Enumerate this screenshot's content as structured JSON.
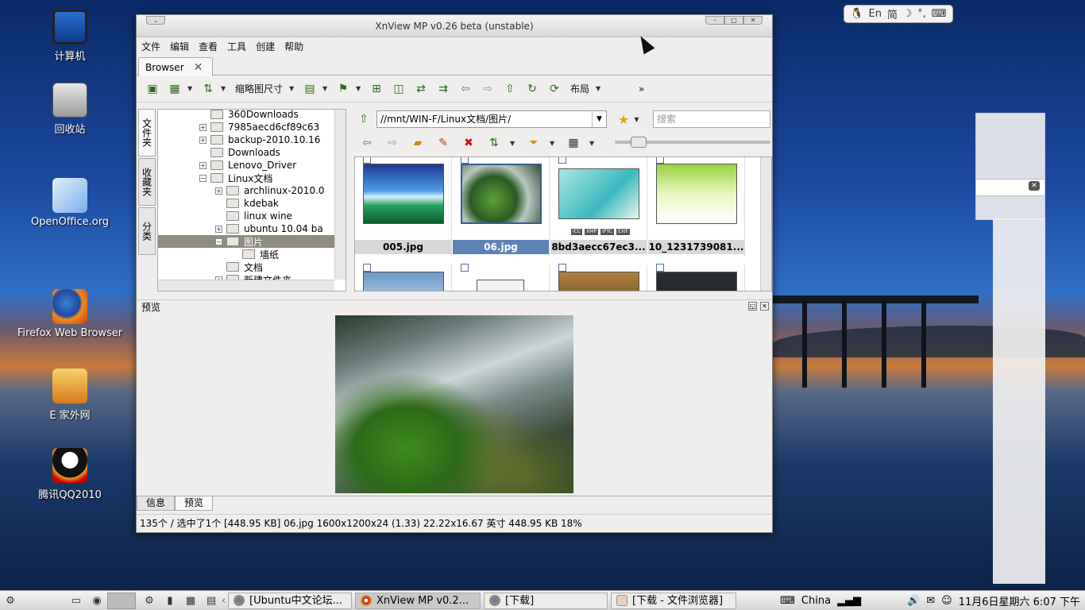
{
  "desktop": {
    "icons": [
      {
        "label": "计算机"
      },
      {
        "label": "回收站"
      },
      {
        "label": "OpenOffice.org"
      },
      {
        "label": "Firefox Web Browser"
      },
      {
        "label": "E 家外网"
      },
      {
        "label": "腾讯QQ2010"
      }
    ]
  },
  "imbar": {
    "lang": "En",
    "mode": "简",
    "moon": "☽",
    "punct": "°,",
    "keyboard": "⌨",
    "penguin": "🐧"
  },
  "window": {
    "title": "XnView MP v0.26 beta (unstable)",
    "menu": [
      "文件",
      "编辑",
      "查看",
      "工具",
      "创建",
      "帮助"
    ],
    "tab": {
      "label": "Browser",
      "close": "✕"
    },
    "toolbar": {
      "thumb_size_label": "缩略图尺寸",
      "layout_label": "布局",
      "more": "»"
    },
    "side_tabs": [
      "文件夹",
      "收藏夹",
      "分类"
    ],
    "tree": [
      {
        "label": "360Downloads",
        "indent": 0,
        "expander": ""
      },
      {
        "label": "7985aecd6cf89c63",
        "indent": 0,
        "expander": "+"
      },
      {
        "label": "backup-2010.10.16",
        "indent": 0,
        "expander": "+"
      },
      {
        "label": "Downloads",
        "indent": 0,
        "expander": ""
      },
      {
        "label": "Lenovo_Driver",
        "indent": 0,
        "expander": "+"
      },
      {
        "label": "Linux文档",
        "indent": 0,
        "expander": "−"
      },
      {
        "label": "archlinux-2010.0",
        "indent": 1,
        "expander": "+"
      },
      {
        "label": "kdebak",
        "indent": 1,
        "expander": ""
      },
      {
        "label": "linux wine",
        "indent": 1,
        "expander": ""
      },
      {
        "label": "ubuntu 10.04 ba",
        "indent": 1,
        "expander": "+"
      },
      {
        "label": "图片",
        "indent": 1,
        "expander": "−",
        "selected": true
      },
      {
        "label": "墙纸",
        "indent": 2,
        "expander": ""
      },
      {
        "label": "文档",
        "indent": 1,
        "expander": ""
      },
      {
        "label": "新建文件夹",
        "indent": 1,
        "expander": "+"
      }
    ],
    "address": "//mnt/WIN-F/Linux文档/图片/",
    "search_placeholder": "搜索",
    "thumbnails": [
      {
        "label": "005.jpg",
        "selected": false,
        "meta": []
      },
      {
        "label": "06.jpg",
        "selected": true,
        "meta": []
      },
      {
        "label": "8bd3aecc67ec3...",
        "selected": false,
        "meta": [
          "ICC",
          "XMP",
          "IPTC",
          "EXIF"
        ]
      },
      {
        "label": "10_1231739081...",
        "selected": false,
        "meta": []
      }
    ],
    "preview_title": "预览",
    "bottom_tabs": [
      "信息",
      "预览"
    ],
    "status": "135个 / 选中了1个 [448.95 KB]  06.jpg  1600x1200x24 (1.33)  22.22x16.67 英寸  448.95 KB  18%"
  },
  "taskbar": {
    "tasks": [
      {
        "label": "[Ubuntu中文论坛..."
      },
      {
        "label": "XnView MP v0.2..."
      },
      {
        "label": "[下载]"
      },
      {
        "label": "[下载 - 文件浏览器]"
      }
    ],
    "ime": "China",
    "clock": "11月6日星期六  6:07 下午"
  }
}
